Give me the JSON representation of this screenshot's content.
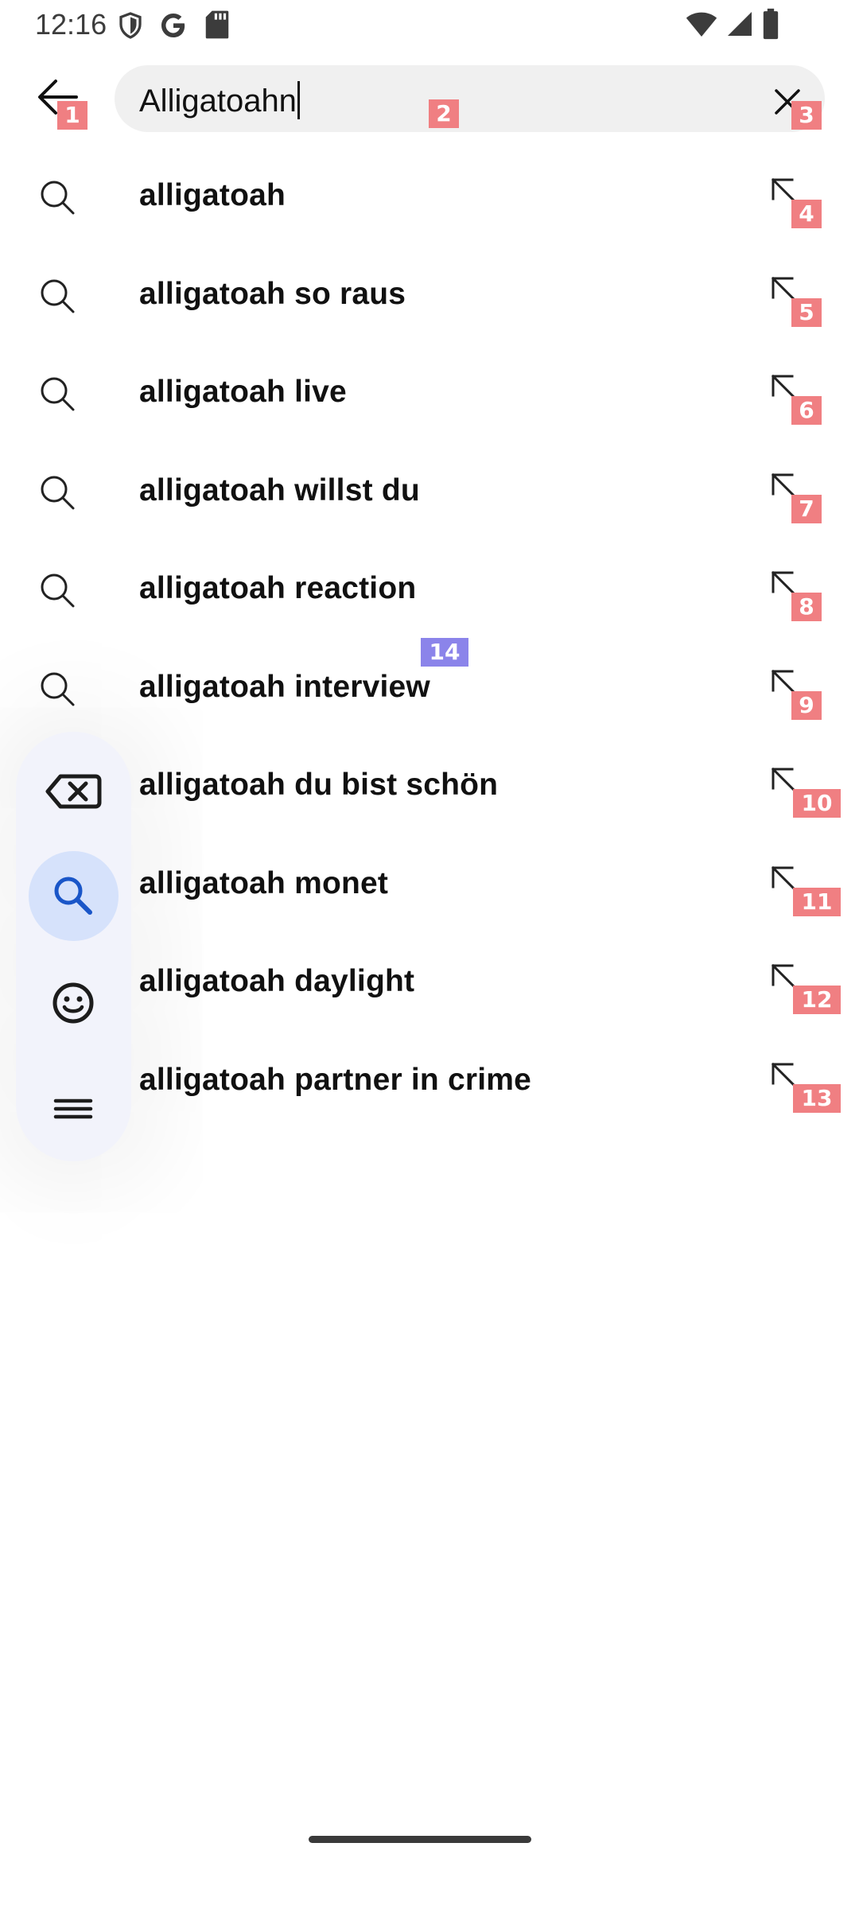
{
  "status_bar": {
    "time": "12:16",
    "left_icons": [
      "shield-icon",
      "google-icon",
      "sd-card-icon"
    ],
    "right_icons": [
      "wifi-icon",
      "signal-icon",
      "battery-icon"
    ]
  },
  "search": {
    "value": "Alligatoahn",
    "back_icon": "arrow-back-icon",
    "clear_icon": "close-icon"
  },
  "suggestions": [
    {
      "text": "alligatoah",
      "badge": "4"
    },
    {
      "text": "alligatoah so raus",
      "badge": "5"
    },
    {
      "text": "alligatoah live",
      "badge": "6"
    },
    {
      "text": "alligatoah willst du",
      "badge": "7"
    },
    {
      "text": "alligatoah reaction",
      "badge": "8"
    },
    {
      "text": "alligatoah interview",
      "badge": "9"
    },
    {
      "text": "alligatoah du bist schön",
      "badge": "10"
    },
    {
      "text": "alligatoah monet",
      "badge": "11"
    },
    {
      "text": "alligatoah daylight",
      "badge": "12"
    },
    {
      "text": "alligatoah partner in crime",
      "badge": "13"
    }
  ],
  "badges": {
    "back": "1",
    "search_box": "2",
    "clear": "3",
    "floating_toolbar": "14"
  },
  "floating_toolbar": {
    "buttons": [
      "backspace-icon",
      "search-icon",
      "emoji-icon",
      "menu-icon"
    ],
    "active": "search-icon",
    "active_color": "#d6e2fb"
  },
  "colors": {
    "badge_red": "#f07f82",
    "badge_purple": "#8b84ea",
    "search_box_bg": "#f0f0f0"
  }
}
